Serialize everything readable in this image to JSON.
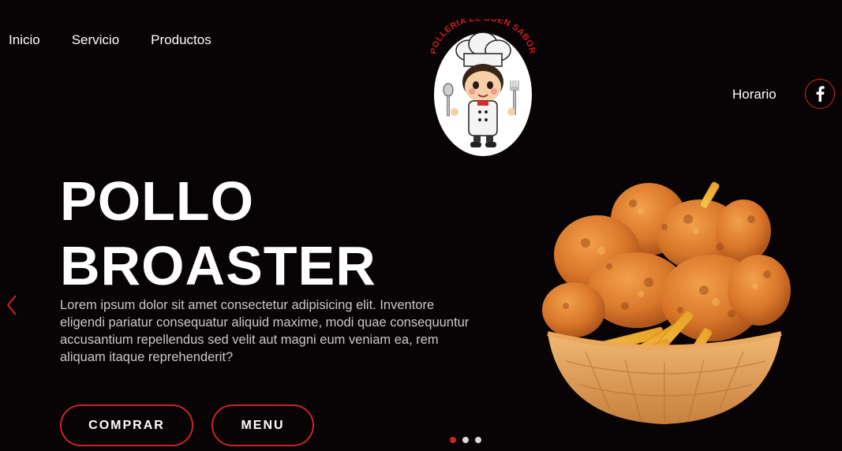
{
  "nav": {
    "items": [
      {
        "label": "Inicio"
      },
      {
        "label": "Servicio"
      },
      {
        "label": "Productos"
      }
    ]
  },
  "brand": {
    "logo_text": "POLLERIA EL BUEN SABOR"
  },
  "header_right": {
    "horario_label": "Horario",
    "social_icon": "facebook-icon"
  },
  "hero": {
    "title_line1": "POLLO",
    "title_line2": "BROASTER",
    "description": "Lorem ipsum dolor sit amet consectetur adipisicing elit. Inventore eligendi pariatur consequatur aliquid maxime, modi quae consequuntur accusantium repellendus sed velit aut magni eum veniam ea, rem aliquam itaque reprehenderit?",
    "buttons": {
      "comprar": "COMPRAR",
      "menu": "MENU"
    },
    "image": "fried-chicken-bowl"
  },
  "carousel": {
    "prev_icon": "chevron-left-icon",
    "slide_count": 3,
    "active_slide": 1
  },
  "colors": {
    "background": "#080305",
    "accent": "#c92525",
    "text": "#ffffff",
    "muted_text": "#c9c9c9"
  }
}
